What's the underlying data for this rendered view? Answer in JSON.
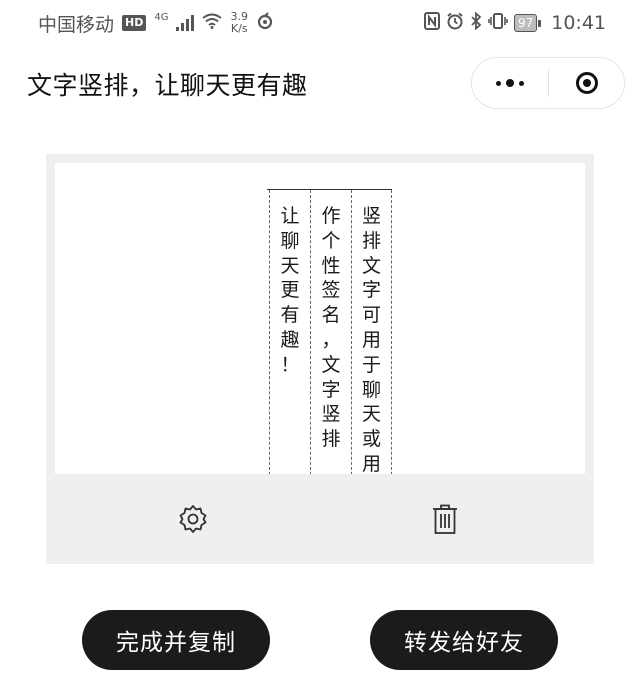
{
  "status_bar": {
    "carrier": "中国移动",
    "hd": "HD",
    "network": "4G",
    "speed_value": "3.9",
    "speed_unit": "K/s",
    "battery": "97",
    "time": "10:41"
  },
  "nav": {
    "title": "文字竖排，让聊天更有趣"
  },
  "canvas": {
    "columns": [
      "竖排文字可用于聊天或用",
      "作个性签名，文字竖排",
      "让聊天更有趣！"
    ]
  },
  "actions": {
    "done_label": "完成并复制",
    "share_label": "转发给好友"
  },
  "icons": {
    "toolbar": [
      "gear-icon",
      "trash-icon"
    ],
    "capsule": [
      "more-dots-icon",
      "target-close-icon"
    ]
  }
}
